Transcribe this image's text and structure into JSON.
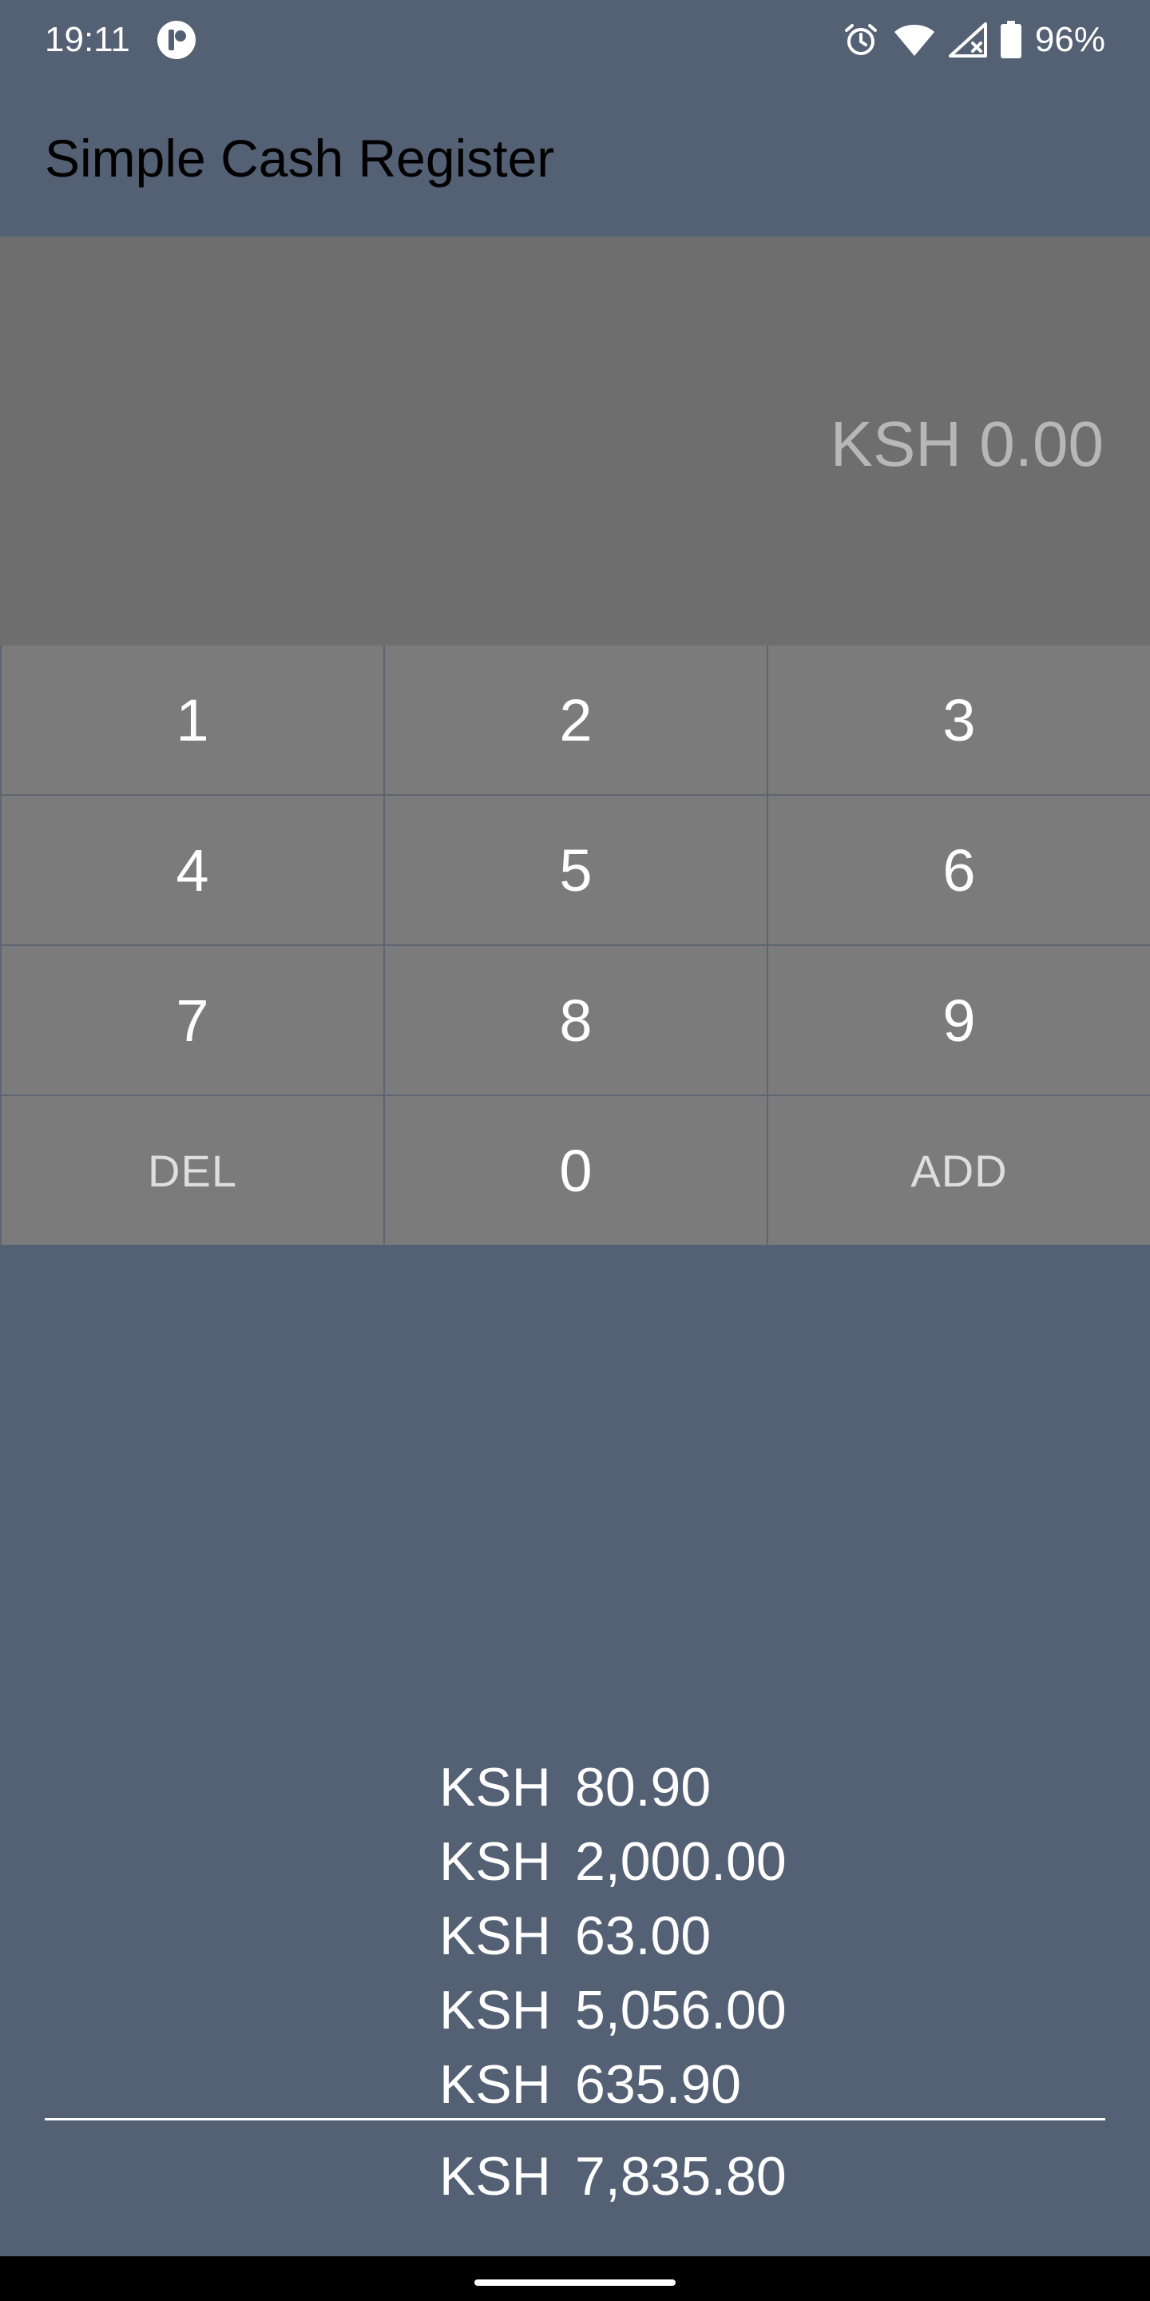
{
  "status_bar": {
    "time": "19:11",
    "battery": "96%",
    "icons": [
      "app-notification-icon",
      "alarm-icon",
      "wifi-icon",
      "cellular-signal-icon",
      "battery-icon"
    ]
  },
  "app_bar": {
    "title": "Simple Cash Register"
  },
  "display": {
    "amount": "KSH 0.00"
  },
  "keypad": {
    "keys": [
      "1",
      "2",
      "3",
      "4",
      "5",
      "6",
      "7",
      "8",
      "9",
      "DEL",
      "0",
      "ADD"
    ]
  },
  "transactions": [
    {
      "currency": "KSH",
      "amount": "80.90"
    },
    {
      "currency": "KSH",
      "amount": "2,000.00"
    },
    {
      "currency": "KSH",
      "amount": "63.00"
    },
    {
      "currency": "KSH",
      "amount": "5,056.00"
    },
    {
      "currency": "KSH",
      "amount": "635.90"
    }
  ],
  "total": {
    "currency": "KSH",
    "amount": "7,835.80"
  },
  "colors": {
    "background": "#546073",
    "display_panel": "#6e6e6e",
    "key": "#7b7b7b",
    "display_text": "#b7b7b7",
    "title_text": "#000000"
  }
}
